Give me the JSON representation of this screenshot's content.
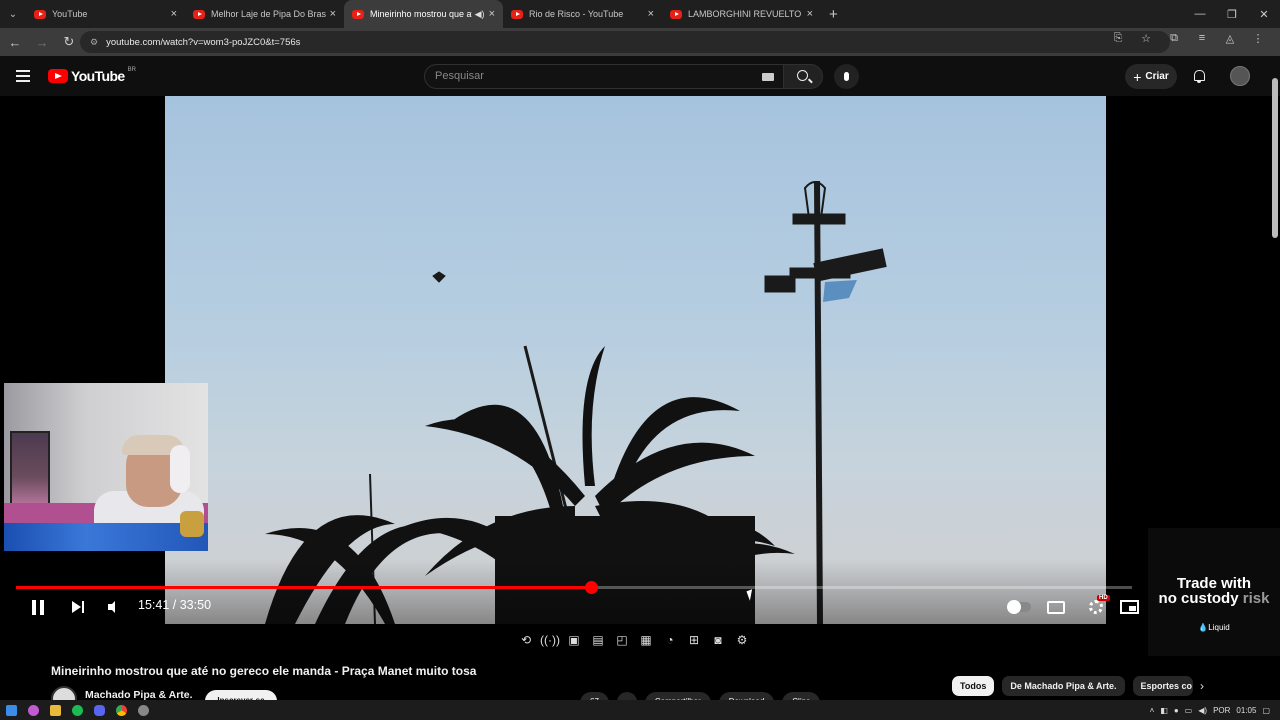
{
  "browser": {
    "tabs": [
      {
        "title": "YouTube",
        "active": false
      },
      {
        "title": "Melhor Laje de Pipa Do Brasil -",
        "active": false
      },
      {
        "title": "Mineirinho mostrou que até",
        "active": true,
        "audio": true
      },
      {
        "title": "Rio de Risco - YouTube",
        "active": false
      },
      {
        "title": "LAMBORGHINI REVUELTO E FE",
        "active": false
      }
    ],
    "url": "youtube.com/watch?v=wom3-poJZC0&t=756s"
  },
  "youtube": {
    "logo_text": "YouTube",
    "region": "BR",
    "search_placeholder": "Pesquisar",
    "create_label": "Criar"
  },
  "player": {
    "current_time": "15:41",
    "separator": "/",
    "duration": "33:50",
    "progress_fraction": 0.515,
    "hd_badge": "HD",
    "accent_color": "#ff0000"
  },
  "ad": {
    "line1": "Trade with",
    "line2_a": "no custody",
    "line2_b": "risk",
    "brand": "Liquid"
  },
  "video": {
    "title": "Mineirinho mostrou que até no gereco ele manda - Praça Manet muito tosa",
    "channel": "Machado Pipa & Arte.",
    "subscribe": "Inscrever-se",
    "actions": [
      "67",
      "",
      "Compartilhar",
      "Download",
      "Clips"
    ]
  },
  "chips": [
    "Todos",
    "De Machado Pipa & Arte.",
    "Esportes co"
  ],
  "taskbar": {
    "lang": "POR",
    "time": "01:05"
  }
}
